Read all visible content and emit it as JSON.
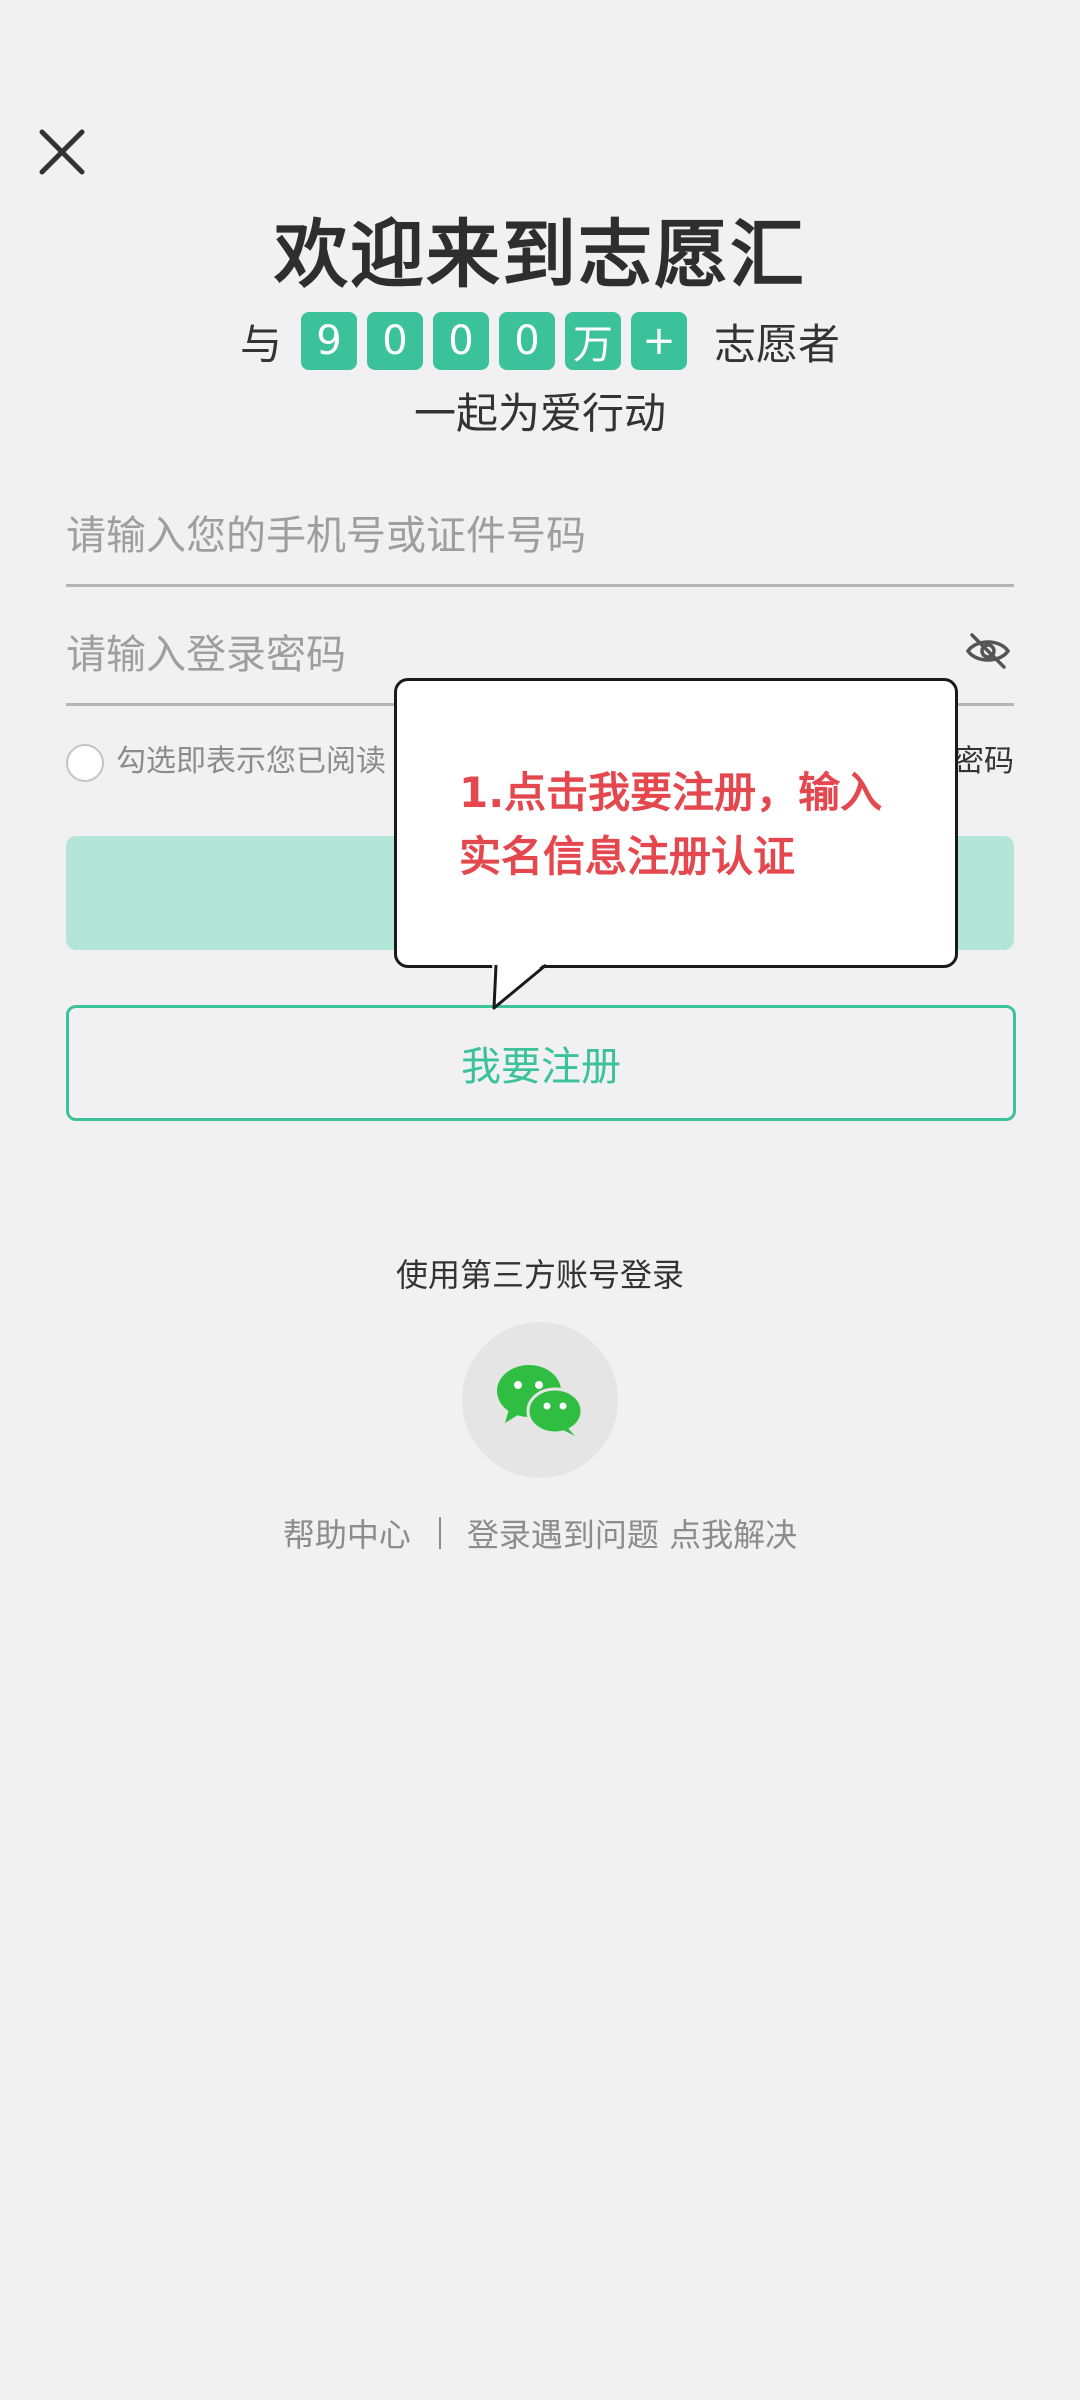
{
  "header": {
    "title": "欢迎来到志愿汇",
    "subtitle_prefix": "与",
    "counter_chars": [
      "9",
      "0",
      "0",
      "0",
      "万",
      "+"
    ],
    "subtitle_suffix": "志愿者",
    "tagline": "一起为爱行动"
  },
  "form": {
    "phone_placeholder": "请输入您的手机号或证件号码",
    "password_placeholder": "请输入登录密码",
    "agreement_text": "勾选即表示您已阅读",
    "forgot_password": "密码",
    "register_label": "我要注册"
  },
  "callout": {
    "text": "1.点击我要注册，输入\n实名信息注册认证"
  },
  "third_party": {
    "title": "使用第三方账号登录",
    "wechat_icon": "wechat-icon"
  },
  "footer": {
    "help_center": "帮助中心",
    "login_problem": "登录遇到问题 点我解决"
  },
  "colors": {
    "accent": "#3cc29b",
    "login_button_disabled": "#b3e6d6",
    "callout_text": "#e5474e",
    "background": "#f1f1f1"
  }
}
